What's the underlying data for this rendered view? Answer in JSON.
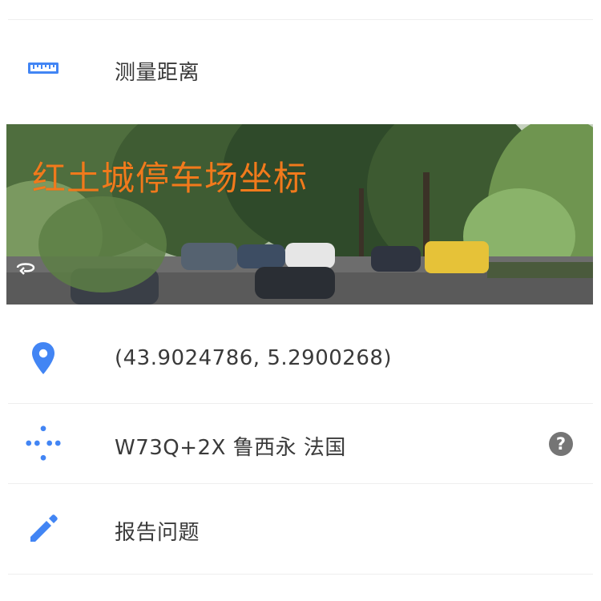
{
  "menu": {
    "measure_label": "测量距离",
    "coordinates_label": "(43.9024786, 5.2900268)",
    "plus_code_label": "W73Q+2X 鲁西永 法国",
    "report_label": "报告问题"
  },
  "photo": {
    "caption": "红土城停车场坐标"
  },
  "help_glyph": "?",
  "colors": {
    "accent_blue": "#4285f4",
    "caption_orange": "#f07a1c",
    "help_gray": "#757575"
  }
}
